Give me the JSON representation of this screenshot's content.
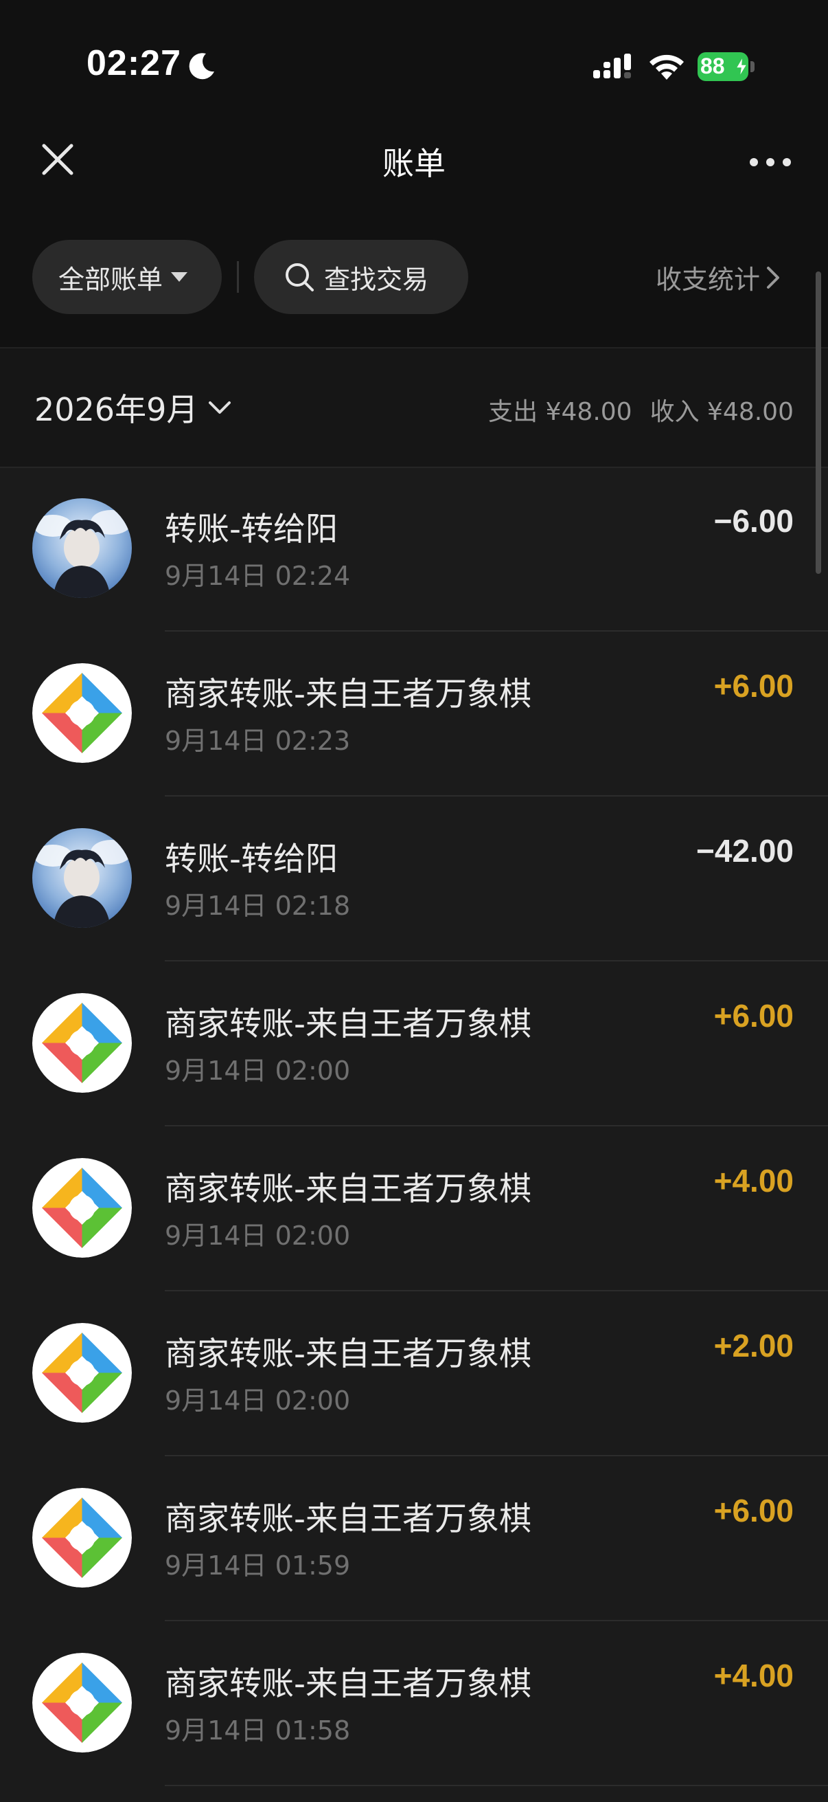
{
  "status_bar": {
    "time": "02:27",
    "battery": "88",
    "icons": [
      "moon-icon",
      "signal-icon",
      "wifi-icon",
      "battery-icon"
    ]
  },
  "nav": {
    "title": "账单",
    "close_icon": "close-icon",
    "more_icon": "more-icon"
  },
  "filters": {
    "all_label": "全部账单",
    "search_label": "查找交易",
    "stats_label": "收支统计"
  },
  "month": {
    "label": "2026年9月",
    "expense": "支出 ¥48.00",
    "income": "收入 ¥48.00"
  },
  "colors": {
    "background": "#1b1b1b",
    "income": "#d9a222",
    "expense": "#e8e8e8",
    "battery": "#31c552"
  },
  "transactions": [
    {
      "title": "转账-转给阳",
      "time": "9月14日 02:24",
      "amount": "−6.00",
      "type": "out",
      "avatar": "user-avatar"
    },
    {
      "title": "商家转账-来自王者万象棋",
      "time": "9月14日 02:23",
      "amount": "+6.00",
      "type": "in",
      "avatar": "merchant-logo"
    },
    {
      "title": "转账-转给阳",
      "time": "9月14日 02:18",
      "amount": "−42.00",
      "type": "out",
      "avatar": "user-avatar"
    },
    {
      "title": "商家转账-来自王者万象棋",
      "time": "9月14日 02:00",
      "amount": "+6.00",
      "type": "in",
      "avatar": "merchant-logo"
    },
    {
      "title": "商家转账-来自王者万象棋",
      "time": "9月14日 02:00",
      "amount": "+4.00",
      "type": "in",
      "avatar": "merchant-logo"
    },
    {
      "title": "商家转账-来自王者万象棋",
      "time": "9月14日 02:00",
      "amount": "+2.00",
      "type": "in",
      "avatar": "merchant-logo"
    },
    {
      "title": "商家转账-来自王者万象棋",
      "time": "9月14日 01:59",
      "amount": "+6.00",
      "type": "in",
      "avatar": "merchant-logo"
    },
    {
      "title": "商家转账-来自王者万象棋",
      "time": "9月14日 01:58",
      "amount": "+4.00",
      "type": "in",
      "avatar": "merchant-logo"
    }
  ]
}
